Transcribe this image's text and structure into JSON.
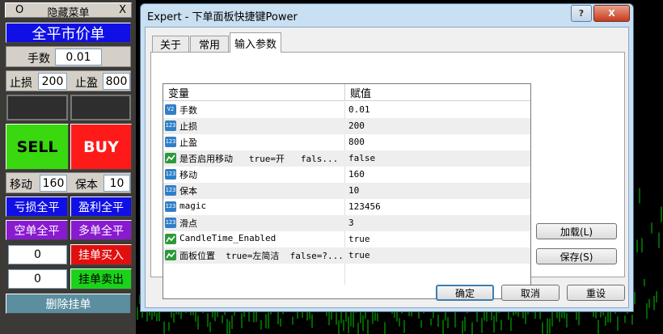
{
  "panel": {
    "title_o": "O",
    "title": "隐藏菜单",
    "title_x": "X",
    "close_all_market": "全平市价单",
    "lots_label": "手数",
    "lots_value": "0.01",
    "sl_label": "止损",
    "sl_value": "200",
    "tp_label": "止盈",
    "tp_value": "800",
    "sell": "SELL",
    "buy": "BUY",
    "trail_label": "移动",
    "trail_value": "160",
    "be_label": "保本",
    "be_value": "10",
    "close_loss": "亏损全平",
    "close_profit": "盈利全平",
    "close_short": "空单全平",
    "close_long": "多单全平",
    "pending_buy_value": "0",
    "pending_buy": "挂单买入",
    "pending_sell_value": "0",
    "pending_sell": "挂单卖出",
    "delete_pending": "删除挂单"
  },
  "dialog": {
    "title": "Expert - 下单面板快捷键Power",
    "tabs": [
      "关于",
      "常用",
      "输入参数"
    ],
    "active_tab": "输入参数",
    "columns": [
      "变量",
      "赋值"
    ],
    "params": [
      {
        "icon": "V2",
        "name": "手数",
        "value": "0.01"
      },
      {
        "icon": "123",
        "name": "止损",
        "value": "200"
      },
      {
        "icon": "123",
        "name": "止盈",
        "value": "800"
      },
      {
        "icon": "bool",
        "name": "是否启用移动   true=开   fals...",
        "value": "false"
      },
      {
        "icon": "123",
        "name": "移动",
        "value": "160"
      },
      {
        "icon": "123",
        "name": "保本",
        "value": "10"
      },
      {
        "icon": "123",
        "name": "magic",
        "value": "123456"
      },
      {
        "icon": "123",
        "name": "滑点",
        "value": "3"
      },
      {
        "icon": "bool",
        "name": "CandleTime_Enabled",
        "value": "true"
      },
      {
        "icon": "bool",
        "name": "面板位置  true=左简洁  false=?...",
        "value": "true"
      }
    ],
    "load": "加载(L)",
    "save": "保存(S)",
    "ok": "确定",
    "cancel": "取消",
    "reset": "重设",
    "title_help": "?",
    "title_close": "X"
  },
  "colors": {
    "sell": "#39d80f",
    "buy": "#ff1a1a",
    "blue_btn": "#1010e6",
    "purple_btn": "#8a1ad0",
    "red_btn": "#e20f0f",
    "green_btn": "#1bd21b",
    "teal_btn": "#5b8fa0"
  }
}
